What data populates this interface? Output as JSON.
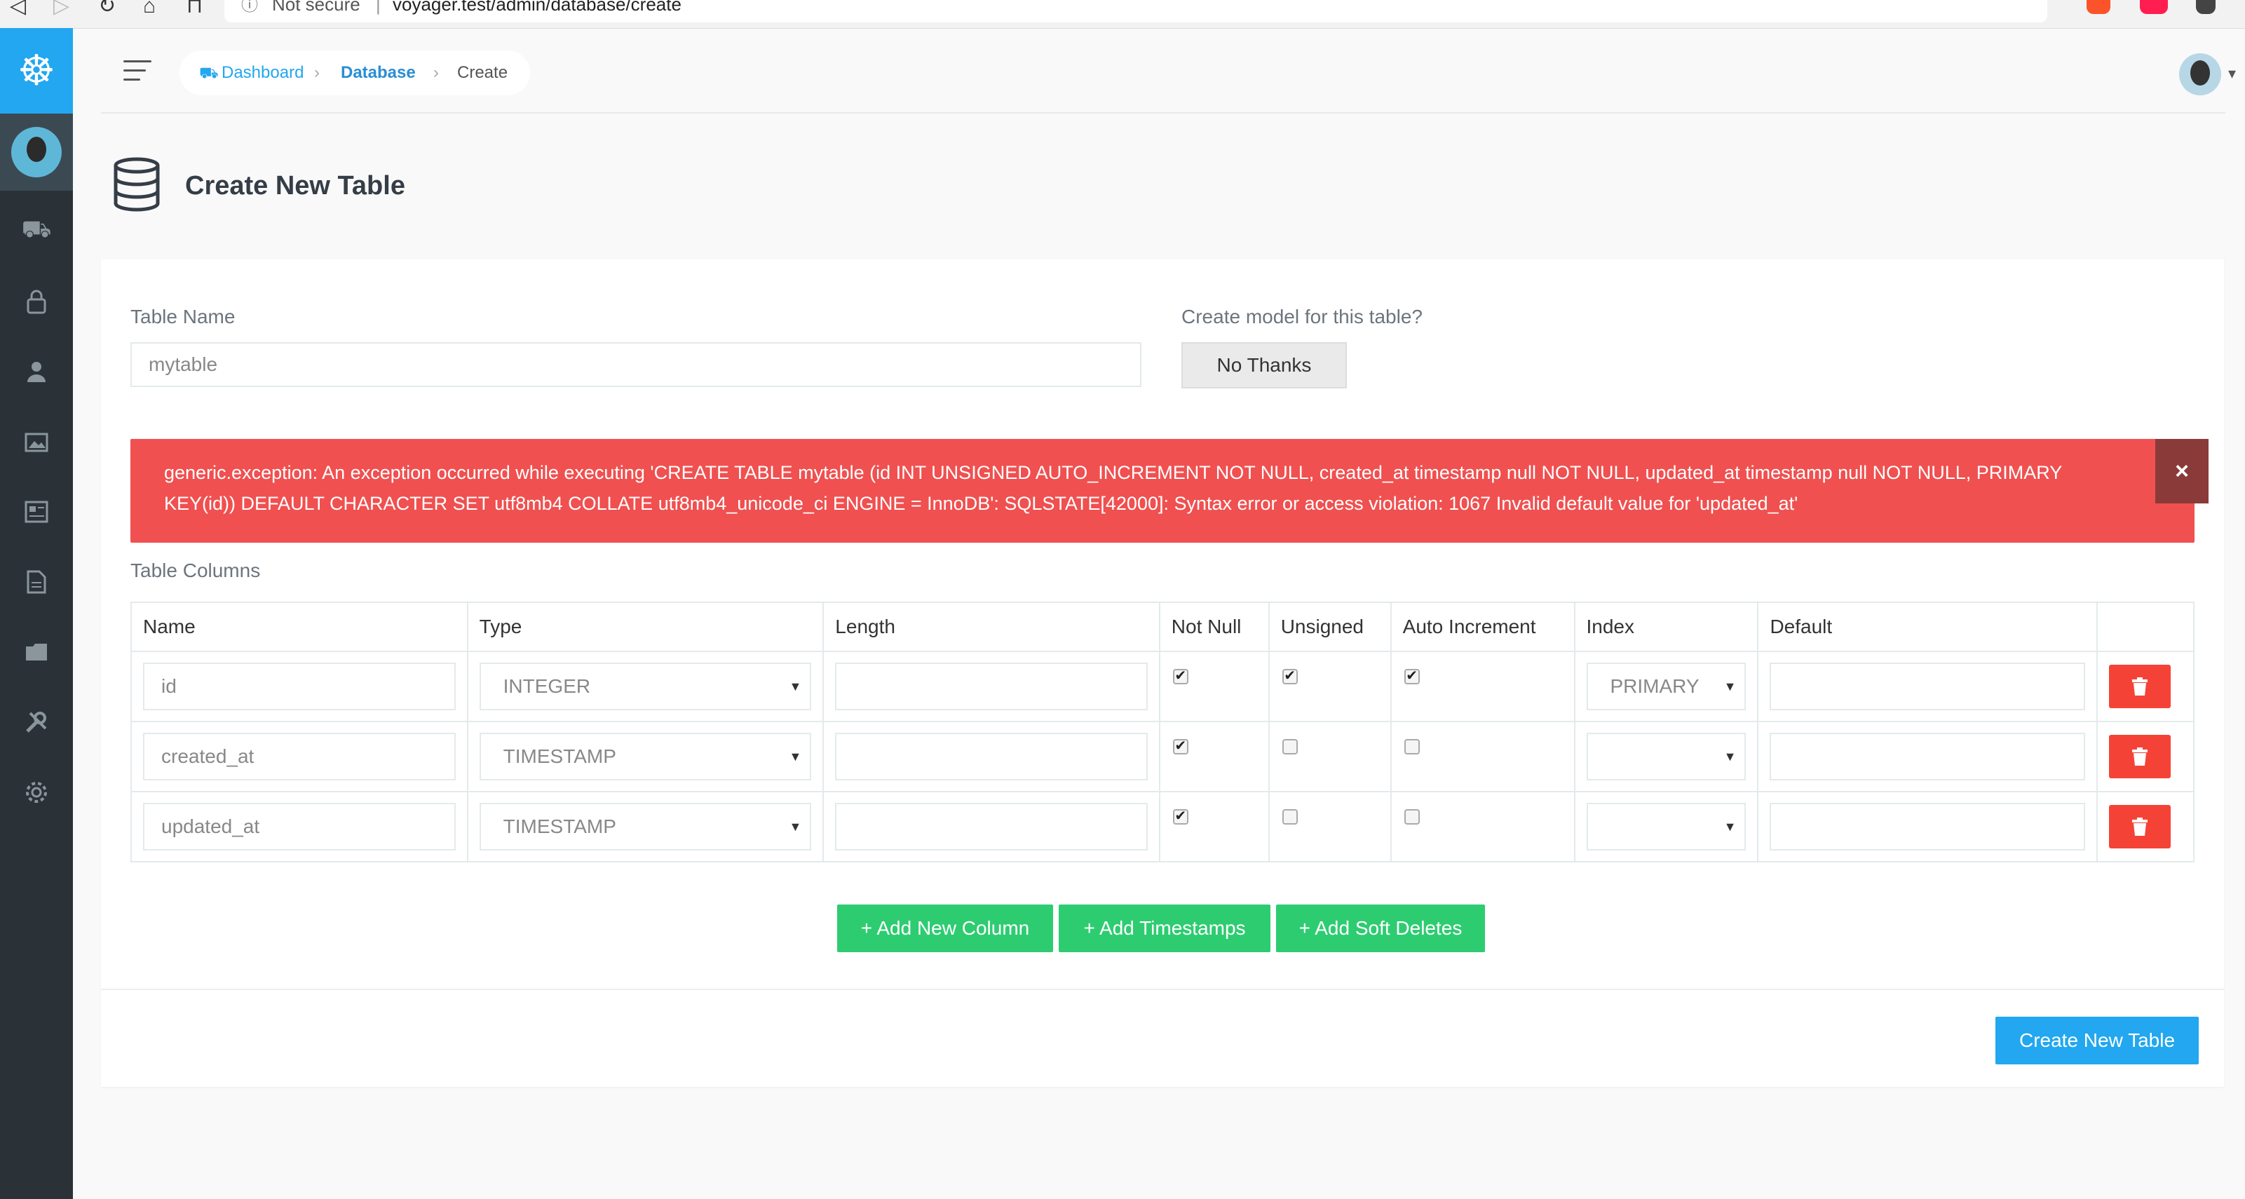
{
  "browser": {
    "security_label": "Not secure",
    "separator": "|",
    "url": "voyager.test/admin/database/create"
  },
  "sidebar": {
    "items": [
      "dashboard-icon",
      "lock-icon",
      "user-icon",
      "media-icon",
      "posts-icon",
      "pages-icon",
      "categories-icon",
      "tools-icon",
      "settings-icon"
    ]
  },
  "breadcrumb": {
    "dashboard": "Dashboard",
    "separator": "›",
    "database": "Database",
    "current": "Create"
  },
  "page": {
    "title": "Create New Table"
  },
  "form": {
    "table_name_label": "Table Name",
    "table_name_value": "mytable",
    "model_label": "Create model for this table?",
    "model_button": "No Thanks"
  },
  "alert": {
    "message": "generic.exception: An exception occurred while executing 'CREATE TABLE mytable (id INT UNSIGNED AUTO_INCREMENT NOT NULL, created_at timestamp null NOT NULL, updated_at timestamp null NOT NULL, PRIMARY KEY(id)) DEFAULT CHARACTER SET utf8mb4 COLLATE utf8mb4_unicode_ci ENGINE = InnoDB': SQLSTATE[42000]: Syntax error or access violation: 1067 Invalid default value for 'updated_at'",
    "close": "×"
  },
  "columns": {
    "section_label": "Table Columns",
    "headers": [
      "Name",
      "Type",
      "Length",
      "Not Null",
      "Unsigned",
      "Auto Increment",
      "Index",
      "Default",
      ""
    ],
    "rows": [
      {
        "name": "id",
        "type": "INTEGER",
        "length": "",
        "not_null": true,
        "unsigned": true,
        "auto_increment": true,
        "index": "PRIMARY",
        "default": ""
      },
      {
        "name": "created_at",
        "type": "TIMESTAMP",
        "length": "",
        "not_null": true,
        "unsigned": false,
        "auto_increment": false,
        "index": "",
        "default": ""
      },
      {
        "name": "updated_at",
        "type": "TIMESTAMP",
        "length": "",
        "not_null": true,
        "unsigned": false,
        "auto_increment": false,
        "index": "",
        "default": ""
      }
    ]
  },
  "actions": {
    "add_column": "+ Add New Column",
    "add_timestamps": "+ Add Timestamps",
    "add_soft_deletes": "+ Add Soft Deletes",
    "submit": "Create New Table"
  },
  "colors": {
    "sidebar": "#2a3237",
    "accent": "#22a7f0",
    "danger": "#f05050",
    "delete": "#f44336",
    "success": "#2ecc71"
  }
}
